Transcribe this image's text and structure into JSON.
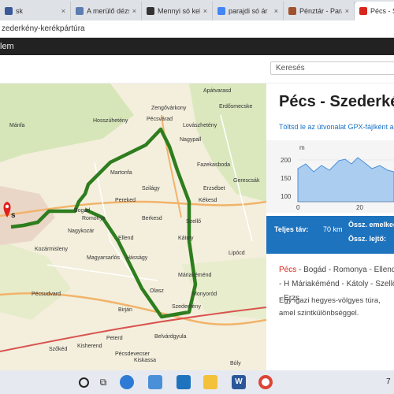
{
  "browser": {
    "tabs": [
      {
        "label": "sk",
        "color": "#3b5998",
        "active": false
      },
      {
        "label": "A merülő dézsm",
        "color": "#5b7db1",
        "active": false
      },
      {
        "label": "Mennyi só kell",
        "color": "#333333",
        "active": false
      },
      {
        "label": "parajdi só ár",
        "color": "#4285f4",
        "active": false
      },
      {
        "label": "Pénztár - Paraj",
        "color": "#a0522d",
        "active": false
      },
      {
        "label": "Pécs - Szederk",
        "color": "#d9261c",
        "active": true
      }
    ],
    "address": "zederkény-kerékpártúra",
    "close_glyph": "×"
  },
  "site": {
    "nav_label": "lem",
    "search_placeholder": "Keresés"
  },
  "map": {
    "towns": [
      {
        "name": "Apátvarasd"
      },
      {
        "name": "Zengővárkony"
      },
      {
        "name": "Erdősmecske"
      },
      {
        "name": "Pécsvárad"
      },
      {
        "name": "Hosszúhetény"
      },
      {
        "name": "Lovászhetény"
      },
      {
        "name": "Nagypall"
      },
      {
        "name": "Fazekasboda"
      },
      {
        "name": "Martonfa"
      },
      {
        "name": "Gerescsák"
      },
      {
        "name": "Erzsébet"
      },
      {
        "name": "Szilágy"
      },
      {
        "name": "Pereked"
      },
      {
        "name": "Kékesd"
      },
      {
        "name": "Berkesd"
      },
      {
        "name": "Szellő"
      },
      {
        "name": "Romonya"
      },
      {
        "name": "Bogád"
      },
      {
        "name": "Nagykozár"
      },
      {
        "name": "Ellend"
      },
      {
        "name": "Kátoly"
      },
      {
        "name": "Kozármisleny"
      },
      {
        "name": "Lipócd"
      },
      {
        "name": "Magyarsarlós"
      },
      {
        "name": "Hásságy"
      },
      {
        "name": "Máriakéménd"
      },
      {
        "name": "Pécsudvard"
      },
      {
        "name": "Olasz"
      },
      {
        "name": "Monyoród"
      },
      {
        "name": "Szederkény"
      },
      {
        "name": "Birján"
      },
      {
        "name": "Szőkéd"
      },
      {
        "name": "Kisherend"
      },
      {
        "name": "Peterd"
      },
      {
        "name": "Belvárdgyula"
      },
      {
        "name": "Pécsdevecser"
      },
      {
        "name": "Kiskassa"
      },
      {
        "name": "Bóly"
      },
      {
        "name": "Mánfa"
      },
      {
        "name": "s"
      }
    ]
  },
  "panel": {
    "title": "Pécs - Szederkén",
    "gpx_link": "Töltsd le az útvonalat GPX-fájlként a",
    "elevation": {
      "y_unit": "m",
      "y_ticks": [
        "200",
        "150",
        "100"
      ],
      "x_ticks": [
        "0",
        "20"
      ]
    },
    "stats": {
      "total_label": "Teljes táv:",
      "total_value": "70 km",
      "ascent_label": "Össz. emelked",
      "descent_label": "Össz. lejtő:"
    },
    "route_start": "Pécs",
    "route_rest": " - Bogád - Romonya - Ellend - H Máriakéménd - Kátoly - Szellő - Erzs",
    "description": "Egy igazi hegyes-völgyes túra, amel szintkülönbséggel."
  },
  "taskbar": {
    "clock": "7"
  }
}
